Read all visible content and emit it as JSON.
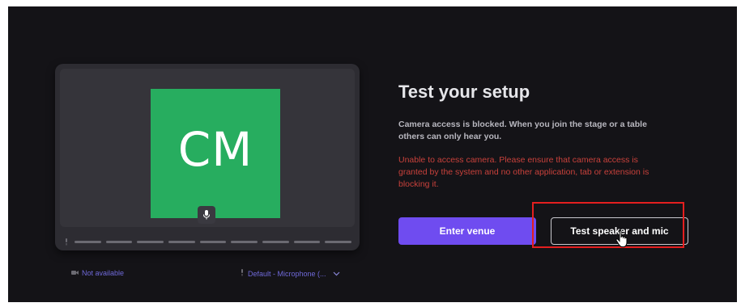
{
  "preview": {
    "avatar_initials": "CM",
    "avatar_color": "#27ad5f",
    "mic_icon": "microphone-icon",
    "level_segments": 9
  },
  "devices": {
    "camera_status": "Not available",
    "camera_icon": "camera-icon",
    "microphone_selected": "Default - Microphone (...",
    "microphone_icon": "microphone-icon",
    "dropdown_icon": "chevron-down-icon"
  },
  "setup": {
    "title": "Test your setup",
    "info": "Camera access is blocked. When you join the stage or a table others can only hear you.",
    "error": "Unable to access camera. Please ensure that camera access is granted by the system and no other application, tab or extension is blocking it.",
    "enter_label": "Enter venue",
    "test_label": "Test speaker and mic"
  },
  "colors": {
    "background": "#141317",
    "accent": "#6f4cf0",
    "error": "#c8413b",
    "highlight": "#e41f1f"
  }
}
